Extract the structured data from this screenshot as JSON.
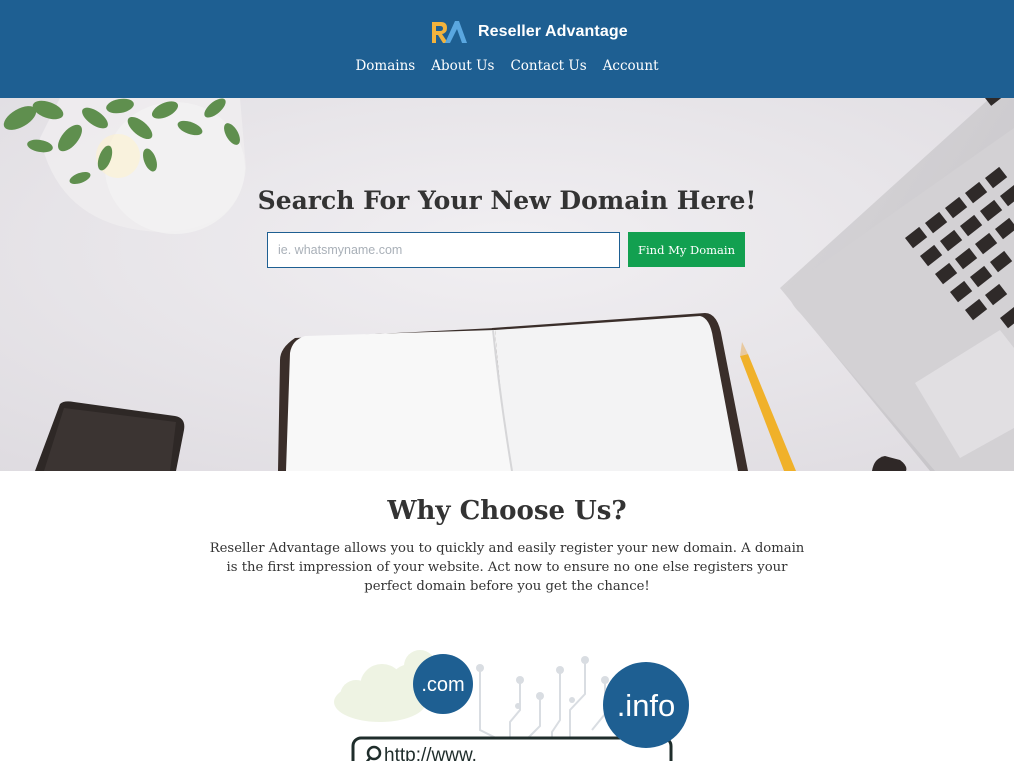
{
  "header": {
    "logo_mark": "RA",
    "logo_name": "Reseller Advantage",
    "nav": [
      {
        "label": "Domains"
      },
      {
        "label": "About Us"
      },
      {
        "label": "Contact Us"
      },
      {
        "label": "Account"
      }
    ]
  },
  "hero": {
    "title": "Search For Your New Domain Here!",
    "search_placeholder": "ie. whatsmyname.com",
    "search_value": "",
    "button_label": "Find My Domain"
  },
  "why": {
    "title": "Why Choose Us?",
    "text": "Reseller Advantage allows you to quickly and easily register your new domain. A domain is the first impression of your website. Act now to ensure no one else registers your perfect domain before you get the chance!"
  },
  "illustration": {
    "tld_com": ".com",
    "tld_info": ".info",
    "url_text": "http://www."
  },
  "colors": {
    "header_bg": "#1e5f92",
    "button_bg": "#12a050",
    "logo_gold": "#f2b33d",
    "logo_blue": "#5aa7e0"
  }
}
